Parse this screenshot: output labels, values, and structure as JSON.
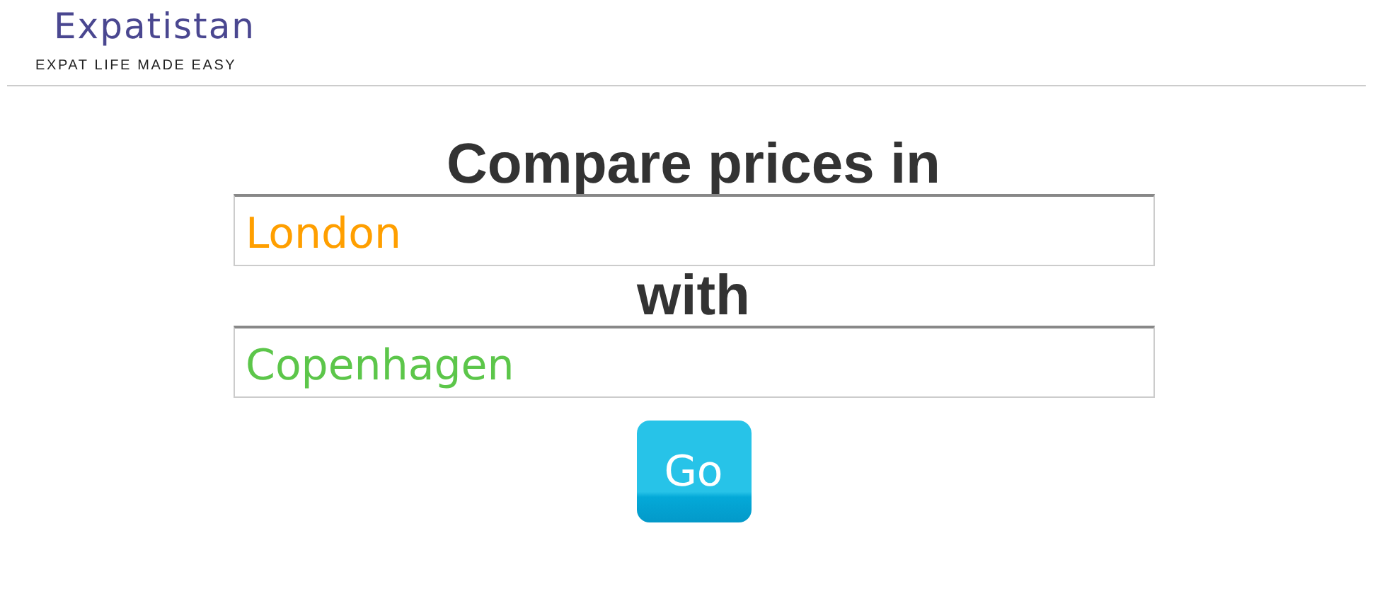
{
  "header": {
    "logo": "Expatistan",
    "tagline": "EXPAT LIFE MADE EASY"
  },
  "form": {
    "heading": "Compare prices in",
    "fields": [
      {
        "value": "London",
        "color": "#ff9f00"
      },
      {
        "value": "Copenhagen",
        "color": "#5cc64a"
      }
    ],
    "connector": "with",
    "button": "Go"
  }
}
